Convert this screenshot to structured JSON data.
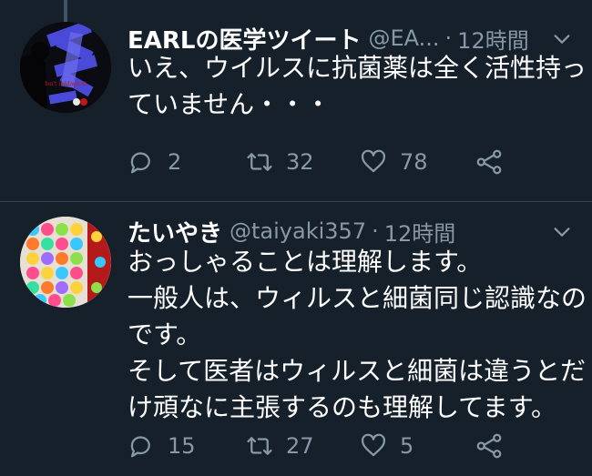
{
  "tweets": [
    {
      "name": "EARLの医学ツイート",
      "handle": "@EA...",
      "separator": "·",
      "time": "12時間",
      "text_lines": [
        "いえ、ウイルスに抗菌薬は全く活性持っ",
        "ていません・・・"
      ],
      "avatar_text": "Isn't it Magical",
      "replies": "2",
      "retweets": "32",
      "likes": "78"
    },
    {
      "name": "たいやき",
      "handle": "@taiyaki357",
      "separator": "·",
      "time": "12時間",
      "text_lines": [
        "おっしゃることは理解します。",
        "一般人は、ウィルスと細菌同じ認識なの",
        "です。",
        "そして医者はウィルスと細菌は違うとだ",
        "け頑なに主張するのも理解してます。"
      ],
      "replies": "15",
      "retweets": "27",
      "likes": "5"
    }
  ],
  "icons": [
    "chevron-down-icon",
    "reply-icon",
    "retweet-icon",
    "like-icon",
    "share-icon"
  ],
  "colors": {
    "background": "#15202b",
    "secondary_text": "#8899a6",
    "divider": "#38444d"
  }
}
